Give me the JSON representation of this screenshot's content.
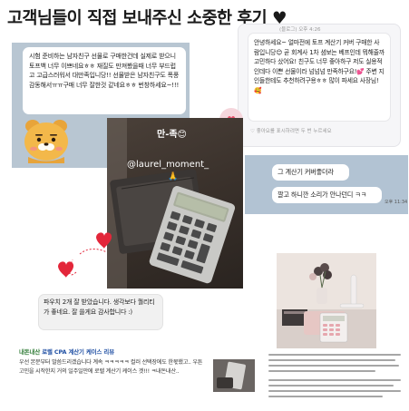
{
  "headline": {
    "text": "고객님들이 직접 보내주신 소중한 후기",
    "heart": "♥"
  },
  "review_kakao_left": {
    "text": "시험 준비하는 남자친구 선물로 구매한건데 실제로 받으니 토프백 너무 이쁘네요ㅎㅎ 재질도 만져봤을때 너무 부드럽고 고급스러워서 대만족입니당!! 선물받은 남자친구도 폭풍감동해서ㅠㅠ구매 너무 잘한것 같네요ㅎㅎ 번창하세요~!!!",
    "emoji": "ryan-character"
  },
  "review_comment_right": {
    "meta": "(블로그) 오후 4:26",
    "text": "안녕하세요~ 얼마전에 토프 계산기 커버 구매한 사람입니당😊 곧 회계사 1차 셤보는 베프인데 뭐해줄까 고민하다 샀어요! 친구도 너무 좋아하구 저도 실용적인데다 이쁜 선물이라 넘넘넘 만족하구요!💕 주변 지인들한테도 추천하려구용ㅎㅎ 많이 파세요 사장님!🥰",
    "like_meta": "좋아요를 표시하려면 두 번 누르세요",
    "heart_icon": "♥"
  },
  "story": {
    "caption": "만-족😊",
    "handle": "@laurel_moment_",
    "emoji": "🙏"
  },
  "chat_right": {
    "msg1": "그 계산기 커버좋더라",
    "msg2": "깔고 하니깐 소리가 안나던디 ㅋㅋ",
    "time": "오후 11:34"
  },
  "chat_bottom": {
    "text": "파우치 2개 잘 받았습니다. 생각보다 퀄리티가 좋네요. 잘 쓸게요 감사합니다 :)"
  },
  "blog_left": {
    "cafe": "내돈내산",
    "title": "로렐 CPA 계산기 케이스 리뷰",
    "body": "우선 본문부터 말씀드리겠습니다 계속 ㅋㅋㅋㅋㅋ 컬러 선택장에도 한몫했고.. 우튼 고민을 시작한지 거의 일주일만에 로렐 계산기 케이스 겟!!! ㅋ내돈내산.."
  },
  "colors": {
    "kakao_bg": "#b8c6d2",
    "blog_link": "#1f4fa3",
    "cafe_green": "#2e7a35",
    "heart_red": "#e3263a"
  }
}
